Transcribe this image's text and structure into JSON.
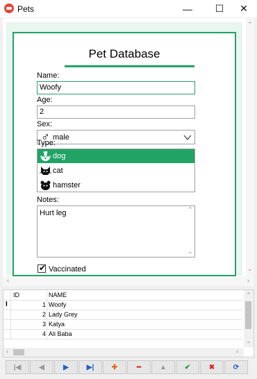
{
  "window": {
    "title": "Pets",
    "minimize": "—",
    "maximize": "☐",
    "close": "✕"
  },
  "form": {
    "title": "Pet Database",
    "name_label": "Name:",
    "name_value": "Woofy",
    "age_label": "Age:",
    "age_value": "2",
    "sex_label": "Sex:",
    "sex_symbol": "♂",
    "sex_value": "male",
    "type_label": "Type:",
    "types": [
      {
        "label": "dog",
        "icon": "dog-icon"
      },
      {
        "label": "cat",
        "icon": "cat-icon"
      },
      {
        "label": "hamster",
        "icon": "hamster-icon"
      }
    ],
    "selected_type": "dog",
    "notes_label": "Notes:",
    "notes_value": "Hurt leg",
    "vaccinated_label": "Vaccinated",
    "vaccinated_checked": true
  },
  "grid": {
    "columns": [
      "ID",
      "NAME"
    ],
    "rows": [
      {
        "id": "1",
        "name": "Woofy"
      },
      {
        "id": "2",
        "name": "Lady Grey"
      },
      {
        "id": "3",
        "name": "Katya"
      },
      {
        "id": "4",
        "name": "Ali Baba"
      }
    ],
    "cursor": "I"
  },
  "navigator": {
    "buttons": [
      {
        "name": "first",
        "glyph": "|◀"
      },
      {
        "name": "prior",
        "glyph": "◀"
      },
      {
        "name": "next",
        "glyph": "▶"
      },
      {
        "name": "last",
        "glyph": "▶|"
      },
      {
        "name": "insert",
        "glyph": "✚"
      },
      {
        "name": "delete",
        "glyph": "━"
      },
      {
        "name": "edit",
        "glyph": "▲"
      },
      {
        "name": "post",
        "glyph": "✔"
      },
      {
        "name": "cancel",
        "glyph": "✖"
      },
      {
        "name": "refresh",
        "glyph": "⟳"
      }
    ]
  },
  "colors": {
    "accent": "#21a366",
    "nav_blue": "#1c5fc9",
    "nav_orange": "#e8641e",
    "nav_red": "#d02828",
    "nav_green": "#1d9a3b"
  }
}
